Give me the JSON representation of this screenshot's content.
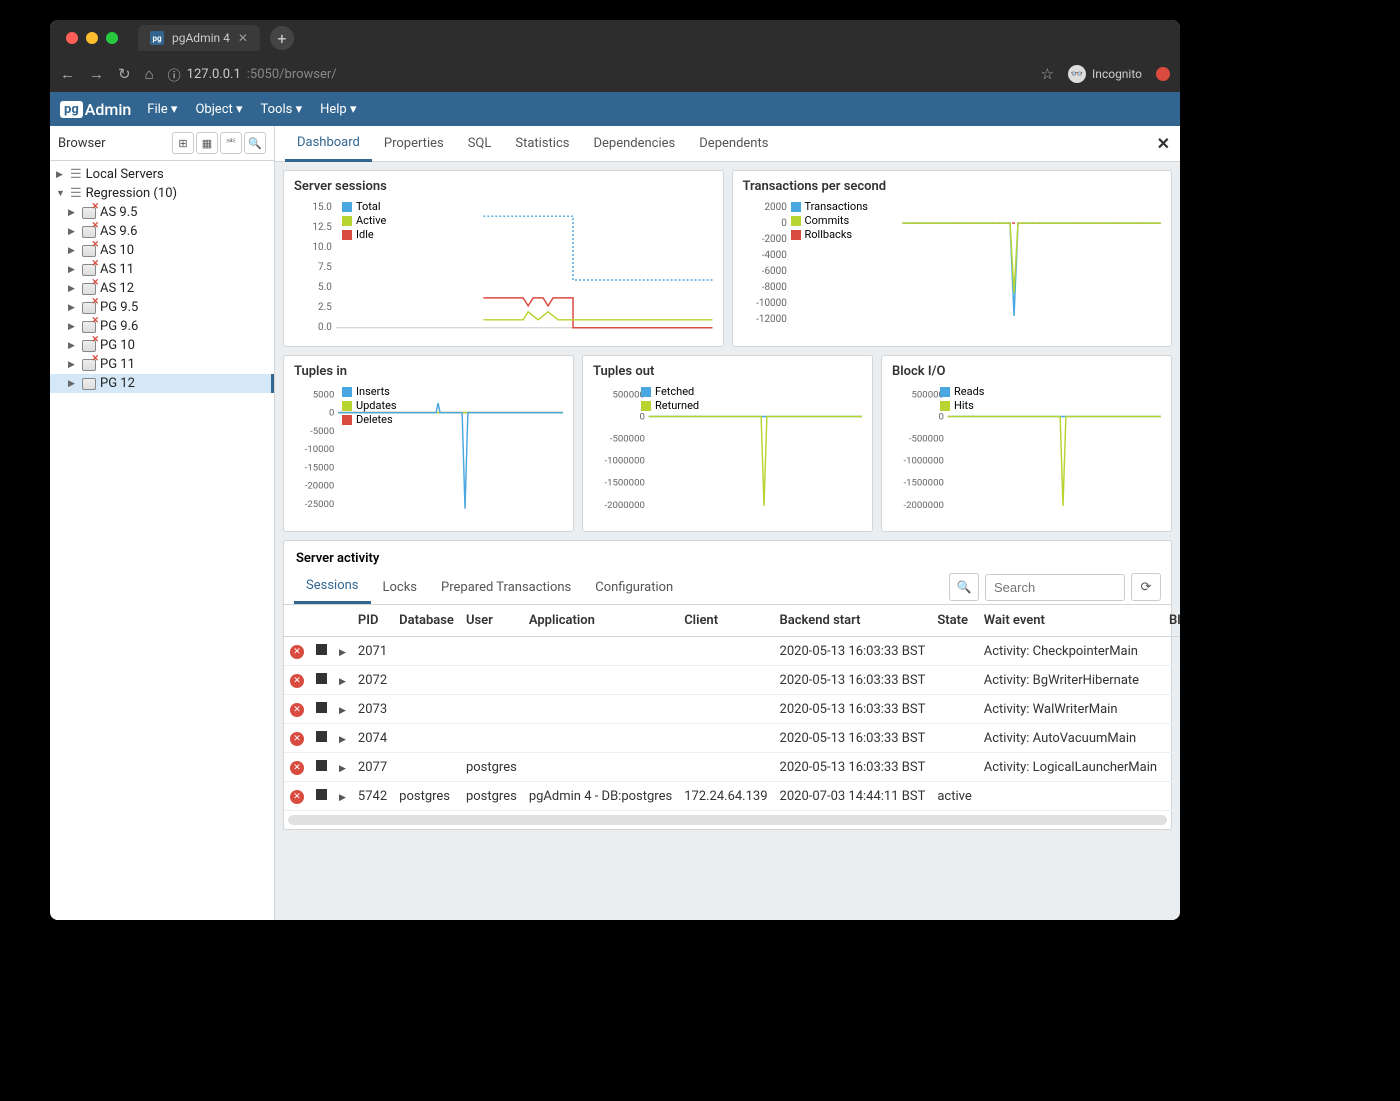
{
  "browser_tab": {
    "title": "pgAdmin 4"
  },
  "url": {
    "host": "127.0.0.1",
    "port_path": ":5050/browser/"
  },
  "incognito_label": "Incognito",
  "pga": {
    "logo_prefix": "pg",
    "logo_text": "Admin",
    "menu": [
      "File",
      "Object",
      "Tools",
      "Help"
    ]
  },
  "browser_panel": {
    "title": "Browser",
    "tree": {
      "local_servers": "Local Servers",
      "regression": "Regression (10)",
      "servers": [
        "AS 9.5",
        "AS 9.6",
        "AS 10",
        "AS 11",
        "AS 12",
        "PG 9.5",
        "PG 9.6",
        "PG 10",
        "PG 11",
        "PG 12"
      ]
    }
  },
  "content_tabs": [
    "Dashboard",
    "Properties",
    "SQL",
    "Statistics",
    "Dependencies",
    "Dependents"
  ],
  "charts": {
    "sessions": {
      "title": "Server sessions",
      "legend": [
        "Total",
        "Active",
        "Idle"
      ],
      "yticks": [
        "15.0",
        "12.5",
        "10.0",
        "7.5",
        "5.0",
        "2.5",
        "0.0"
      ]
    },
    "tps": {
      "title": "Transactions per second",
      "legend": [
        "Transactions",
        "Commits",
        "Rollbacks"
      ],
      "yticks": [
        "2000",
        "0",
        "-2000",
        "-4000",
        "-6000",
        "-8000",
        "-10000",
        "-12000"
      ]
    },
    "tin": {
      "title": "Tuples in",
      "legend": [
        "Inserts",
        "Updates",
        "Deletes"
      ],
      "yticks": [
        "5000",
        "0",
        "-5000",
        "-10000",
        "-15000",
        "-20000",
        "-25000"
      ]
    },
    "tout": {
      "title": "Tuples out",
      "legend": [
        "Fetched",
        "Returned"
      ],
      "yticks": [
        "500000",
        "0",
        "-500000",
        "-1000000",
        "-1500000",
        "-2000000"
      ]
    },
    "bio": {
      "title": "Block I/O",
      "legend": [
        "Reads",
        "Hits"
      ],
      "yticks": [
        "500000",
        "0",
        "-500000",
        "-1000000",
        "-1500000",
        "-2000000"
      ]
    }
  },
  "activity": {
    "title": "Server activity",
    "tabs": [
      "Sessions",
      "Locks",
      "Prepared Transactions",
      "Configuration"
    ],
    "search_placeholder": "Search",
    "columns": [
      "",
      "",
      "",
      "PID",
      "Database",
      "User",
      "Application",
      "Client",
      "Backend start",
      "State",
      "Wait event",
      "Blocking PIDs"
    ],
    "rows": [
      {
        "pid": "2071",
        "db": "",
        "user": "",
        "app": "",
        "client": "",
        "start": "2020-05-13 16:03:33 BST",
        "state": "",
        "wait": "Activity: CheckpointerMain"
      },
      {
        "pid": "2072",
        "db": "",
        "user": "",
        "app": "",
        "client": "",
        "start": "2020-05-13 16:03:33 BST",
        "state": "",
        "wait": "Activity: BgWriterHibernate"
      },
      {
        "pid": "2073",
        "db": "",
        "user": "",
        "app": "",
        "client": "",
        "start": "2020-05-13 16:03:33 BST",
        "state": "",
        "wait": "Activity: WalWriterMain"
      },
      {
        "pid": "2074",
        "db": "",
        "user": "",
        "app": "",
        "client": "",
        "start": "2020-05-13 16:03:33 BST",
        "state": "",
        "wait": "Activity: AutoVacuumMain"
      },
      {
        "pid": "2077",
        "db": "",
        "user": "postgres",
        "app": "",
        "client": "",
        "start": "2020-05-13 16:03:33 BST",
        "state": "",
        "wait": "Activity: LogicalLauncherMain"
      },
      {
        "pid": "5742",
        "db": "postgres",
        "user": "postgres",
        "app": "pgAdmin 4 - DB:postgres",
        "client": "172.24.64.139",
        "start": "2020-07-03 14:44:11 BST",
        "state": "active",
        "wait": ""
      }
    ]
  },
  "chart_data": [
    {
      "type": "line",
      "title": "Server sessions",
      "ylim": [
        0,
        15
      ],
      "series": [
        {
          "name": "Total",
          "values": [
            null,
            null,
            null,
            null,
            null,
            null,
            null,
            null,
            null,
            null,
            14,
            14,
            14,
            14,
            14,
            14,
            14,
            14,
            14,
            14,
            6,
            6,
            6,
            6,
            6,
            6,
            6,
            6,
            6,
            6,
            6,
            6,
            6,
            6,
            6,
            6,
            6,
            6,
            6,
            6
          ]
        },
        {
          "name": "Active",
          "values": [
            null,
            null,
            null,
            null,
            null,
            null,
            null,
            null,
            null,
            null,
            1,
            1,
            1,
            1,
            1,
            1,
            2,
            1,
            2,
            1,
            1,
            1,
            1,
            1,
            1,
            1,
            1,
            1,
            1,
            1,
            1,
            1,
            1,
            1,
            1,
            1,
            1,
            1,
            1,
            1
          ]
        },
        {
          "name": "Idle",
          "values": [
            null,
            null,
            null,
            null,
            null,
            null,
            null,
            null,
            null,
            null,
            4,
            4,
            4,
            4,
            3,
            4,
            3,
            4,
            3,
            4,
            0,
            0,
            0,
            0,
            0,
            0,
            0,
            0,
            0,
            0,
            0,
            0,
            0,
            0,
            0,
            0,
            0,
            0,
            0,
            0
          ]
        }
      ]
    },
    {
      "type": "line",
      "title": "Transactions per second",
      "ylim": [
        -12000,
        2000
      ],
      "series": [
        {
          "name": "Transactions",
          "values": [
            0,
            0,
            0,
            0,
            0,
            0,
            0,
            0,
            0,
            0,
            0,
            0,
            0,
            0,
            0,
            0,
            0,
            0,
            0,
            0,
            0,
            0,
            0,
            0,
            0,
            0,
            -11000,
            0,
            0,
            0,
            0,
            0,
            0,
            0,
            0,
            0,
            0,
            0,
            0,
            0
          ]
        },
        {
          "name": "Commits",
          "values": [
            0,
            0,
            0,
            0,
            0,
            0,
            0,
            0,
            0,
            0,
            0,
            0,
            0,
            0,
            0,
            0,
            0,
            0,
            0,
            0,
            0,
            0,
            0,
            0,
            0,
            0,
            -9000,
            0,
            0,
            0,
            0,
            0,
            0,
            0,
            0,
            0,
            0,
            0,
            0,
            0
          ]
        },
        {
          "name": "Rollbacks",
          "values": [
            0,
            0,
            0,
            0,
            0,
            0,
            0,
            0,
            0,
            0,
            0,
            0,
            0,
            0,
            0,
            0,
            0,
            0,
            0,
            0,
            0,
            0,
            0,
            0,
            0,
            0,
            0,
            0,
            0,
            0,
            0,
            0,
            0,
            0,
            0,
            0,
            0,
            0,
            0,
            0
          ]
        }
      ]
    },
    {
      "type": "line",
      "title": "Tuples in",
      "ylim": [
        -25000,
        5000
      ],
      "series": [
        {
          "name": "Inserts",
          "values": [
            0,
            0,
            0,
            0,
            0,
            0,
            0,
            0,
            0,
            0,
            0,
            2000,
            0,
            0,
            0,
            0,
            0,
            0,
            0,
            0,
            -24000,
            0,
            0,
            0,
            0,
            0,
            0,
            0,
            0,
            0,
            0,
            0,
            0,
            0,
            0,
            0,
            0,
            0,
            0,
            0
          ]
        },
        {
          "name": "Updates",
          "values": [
            0,
            0,
            0,
            0,
            0,
            0,
            0,
            0,
            0,
            0,
            0,
            0,
            0,
            0,
            0,
            0,
            0,
            0,
            0,
            0,
            0,
            0,
            0,
            0,
            0,
            0,
            0,
            0,
            0,
            0,
            0,
            0,
            0,
            0,
            0,
            0,
            0,
            0,
            0,
            0
          ]
        },
        {
          "name": "Deletes",
          "values": [
            0,
            0,
            0,
            0,
            0,
            0,
            0,
            0,
            0,
            0,
            0,
            0,
            0,
            0,
            0,
            0,
            0,
            0,
            0,
            0,
            0,
            0,
            0,
            0,
            0,
            0,
            0,
            0,
            0,
            0,
            0,
            0,
            0,
            0,
            0,
            0,
            0,
            0,
            0,
            0
          ]
        }
      ]
    },
    {
      "type": "line",
      "title": "Tuples out",
      "ylim": [
        -2000000,
        500000
      ],
      "series": [
        {
          "name": "Fetched",
          "values": [
            0,
            0,
            0,
            0,
            0,
            0,
            0,
            0,
            0,
            0,
            0,
            0,
            0,
            0,
            0,
            0,
            0,
            0,
            0,
            0,
            0,
            0,
            0,
            0,
            0,
            0,
            0,
            0,
            0,
            0,
            0,
            0,
            0,
            0,
            0,
            0,
            0,
            0,
            0,
            0
          ]
        },
        {
          "name": "Returned",
          "values": [
            0,
            0,
            0,
            0,
            0,
            0,
            0,
            0,
            0,
            0,
            0,
            0,
            0,
            0,
            0,
            0,
            0,
            0,
            0,
            0,
            -1900000,
            0,
            0,
            0,
            0,
            0,
            0,
            0,
            0,
            0,
            0,
            0,
            0,
            0,
            0,
            0,
            0,
            0,
            0,
            0
          ]
        }
      ]
    },
    {
      "type": "line",
      "title": "Block I/O",
      "ylim": [
        -2000000,
        500000
      ],
      "series": [
        {
          "name": "Reads",
          "values": [
            0,
            0,
            0,
            0,
            0,
            0,
            0,
            0,
            0,
            0,
            0,
            0,
            0,
            0,
            0,
            0,
            0,
            0,
            0,
            0,
            0,
            0,
            0,
            0,
            0,
            0,
            0,
            0,
            0,
            0,
            0,
            0,
            0,
            0,
            0,
            0,
            0,
            0,
            0,
            0
          ]
        },
        {
          "name": "Hits",
          "values": [
            0,
            0,
            0,
            0,
            0,
            0,
            0,
            0,
            0,
            0,
            0,
            0,
            0,
            0,
            0,
            0,
            0,
            0,
            0,
            0,
            -1900000,
            0,
            0,
            0,
            0,
            0,
            0,
            0,
            0,
            0,
            0,
            0,
            0,
            0,
            0,
            0,
            0,
            0,
            0,
            0
          ]
        }
      ]
    }
  ],
  "colors": {
    "blue": "#4aa8e0",
    "green": "#b8d431",
    "red": "#d94b3f",
    "accent": "#326690"
  }
}
